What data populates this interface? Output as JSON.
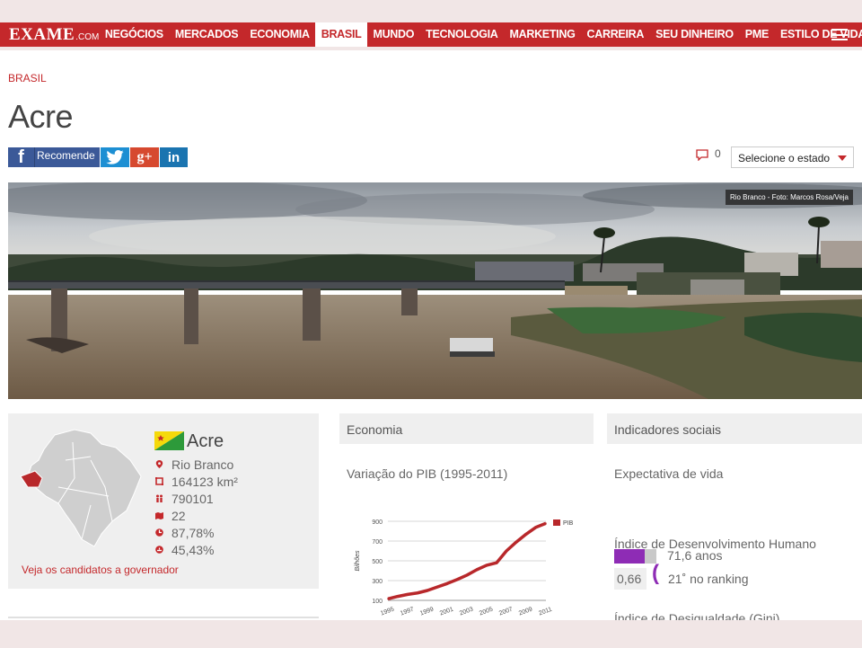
{
  "header": {
    "logo": "EXAME",
    "logo_domain": ".COM",
    "nav": [
      "NEGÓCIOS",
      "MERCADOS",
      "ECONOMIA",
      "BRASIL",
      "MUNDO",
      "TECNOLOGIA",
      "MARKETING",
      "CARREIRA",
      "SEU DINHEIRO",
      "PME",
      "ESTILO DE VIDA"
    ],
    "active_nav": "BRASIL",
    "brand_color": "#c4282b"
  },
  "page": {
    "breadcrumb": "BRASIL",
    "title": "Acre"
  },
  "share": {
    "facebook_label": "Recomende",
    "facebook_icon": "f",
    "twitter_icon": "twitter-bird-icon",
    "googleplus_icon": "g+",
    "linkedin_icon": "in"
  },
  "comments": {
    "count": "0"
  },
  "state_select": {
    "selected": "Selecione o estado"
  },
  "hero": {
    "credit": "Rio Branco - Foto: Marcos Rosa/Veja"
  },
  "state_panel": {
    "name": "Acre",
    "facts": [
      {
        "icon": "map-pin-icon",
        "value": "Rio Branco"
      },
      {
        "icon": "area-icon",
        "value": "164123 km²"
      },
      {
        "icon": "population-icon",
        "value": "790101"
      },
      {
        "icon": "cities-icon",
        "value": "22"
      },
      {
        "icon": "percent-icon",
        "value": "87,78%"
      },
      {
        "icon": "percent-alt-icon",
        "value": "45,43%"
      }
    ],
    "candidates_link": "Veja os candidatos a governador",
    "highlight_color": "#b8282b"
  },
  "economy": {
    "header": "Economia",
    "subtitle": "Variação do PIB (1995-2011)"
  },
  "chart_data": {
    "type": "line",
    "x": [
      1995,
      1996,
      1997,
      1998,
      1999,
      2000,
      2001,
      2002,
      2003,
      2004,
      2005,
      2006,
      2007,
      2008,
      2009,
      2010,
      2011
    ],
    "series": [
      {
        "name": "PIB",
        "values": [
          115,
          140,
          160,
          175,
          200,
          235,
          270,
          310,
          355,
          410,
          455,
          480,
          600,
          690,
          770,
          840,
          880
        ]
      }
    ],
    "xticks": [
      "1995",
      "1997",
      "1999",
      "2001",
      "2003",
      "2005",
      "2007",
      "2009",
      "2011"
    ],
    "yticks": [
      100,
      300,
      500,
      700,
      900
    ],
    "ylabel": "Bilhões",
    "ylim": [
      100,
      900
    ],
    "line_color": "#b8282b",
    "legend": "right"
  },
  "social": {
    "header": "Indicadores sociais",
    "life_expectancy_label": "Expectativa de vida",
    "life_expectancy_value": "71,6 anos",
    "life_expectancy_fraction": 0.72,
    "idh_label": "Índice de Desenvolvimento Humano",
    "idh_value": "0,66",
    "idh_rank": "21˚ no ranking",
    "gini_label": "Índice de Desigualdade (Gini)",
    "accent_color": "#8e2cb5"
  }
}
